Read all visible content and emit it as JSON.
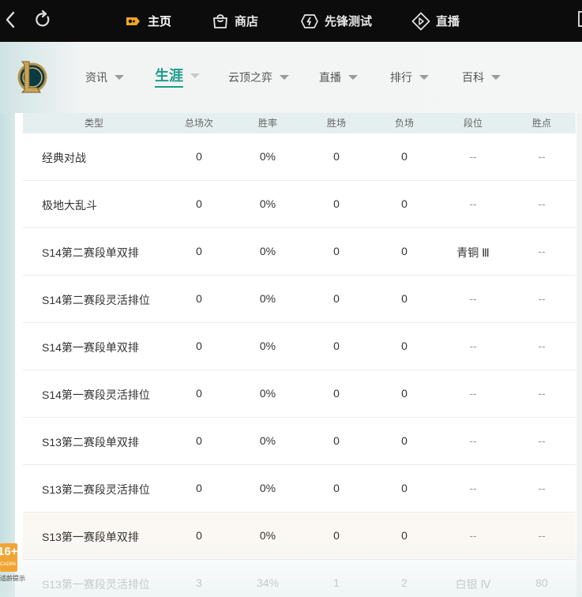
{
  "topbar": {
    "nav": [
      {
        "label": "主页",
        "icon": "gamepad-icon"
      },
      {
        "label": "商店",
        "icon": "shopping-bag-icon"
      },
      {
        "label": "先锋测试",
        "icon": "lightning-icon"
      },
      {
        "label": "直播",
        "icon": "play-diamond-icon"
      }
    ]
  },
  "subnav": {
    "items": [
      {
        "label": "资讯"
      },
      {
        "label": "生涯",
        "active": true
      },
      {
        "label": "云顶之弈"
      },
      {
        "label": "直播"
      },
      {
        "label": "排行"
      },
      {
        "label": "百科"
      }
    ]
  },
  "table": {
    "headers": [
      "类型",
      "总场次",
      "胜率",
      "胜场",
      "负场",
      "段位",
      "胜点"
    ],
    "rows": [
      [
        "经典对战",
        "0",
        "0%",
        "0",
        "0",
        "--",
        "--"
      ],
      [
        "极地大乱斗",
        "0",
        "0%",
        "0",
        "0",
        "--",
        "--"
      ],
      [
        "S14第二赛段单双排",
        "0",
        "0%",
        "0",
        "0",
        "青铜 Ⅲ",
        "--"
      ],
      [
        "S14第二赛段灵活排位",
        "0",
        "0%",
        "0",
        "0",
        "--",
        "--"
      ],
      [
        "S14第一赛段单双排",
        "0",
        "0%",
        "0",
        "0",
        "--",
        "--"
      ],
      [
        "S14第一赛段灵活排位",
        "0",
        "0%",
        "0",
        "0",
        "--",
        "--"
      ],
      [
        "S13第二赛段单双排",
        "0",
        "0%",
        "0",
        "0",
        "--",
        "--"
      ],
      [
        "S13第二赛段灵活排位",
        "0",
        "0%",
        "0",
        "0",
        "--",
        "--"
      ],
      [
        "S13第一赛段单双排",
        "0",
        "0%",
        "0",
        "0",
        "--",
        "--"
      ],
      [
        "S13第一赛段灵活排位",
        "3",
        "34%",
        "1",
        "2",
        "白银 Ⅳ",
        "80"
      ]
    ]
  },
  "age_badge": {
    "number": "16+",
    "small": "CADPA",
    "tip": "适龄提示"
  },
  "colors": {
    "accent": "#1f9c8b",
    "topbar": "#0c0c0c",
    "badge": "#f1a534"
  }
}
